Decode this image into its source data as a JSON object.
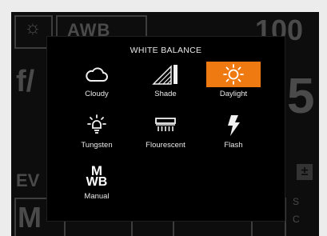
{
  "background_hud": {
    "wb_badge": "AWB",
    "iso_value": "100",
    "aperture_prefix": "f/",
    "shutter_digit": "5",
    "ev_label": "EV",
    "mode_label": "M",
    "side_s": "S",
    "side_c": "C"
  },
  "popup": {
    "title": "WHITE BALANCE",
    "options": [
      {
        "label": "Cloudy",
        "icon": "cloud-icon",
        "selected": false
      },
      {
        "label": "Shade",
        "icon": "shade-icon",
        "selected": false
      },
      {
        "label": "Daylight",
        "icon": "sun-icon",
        "selected": true
      },
      {
        "label": "Tungsten",
        "icon": "tungsten-bulb-icon",
        "selected": false
      },
      {
        "label": "Flourescent",
        "icon": "fluorescent-icon",
        "selected": false
      },
      {
        "label": "Flash",
        "icon": "flash-icon",
        "selected": false
      },
      {
        "label": "Manual",
        "icon": "manual-wb-icon",
        "selected": false
      }
    ],
    "manual_icon_text": {
      "top": "M",
      "bottom": "WB"
    }
  },
  "colors": {
    "accent": "#f07a12",
    "popup_bg": "#000000",
    "screen_bg": "#0d0d0d"
  }
}
